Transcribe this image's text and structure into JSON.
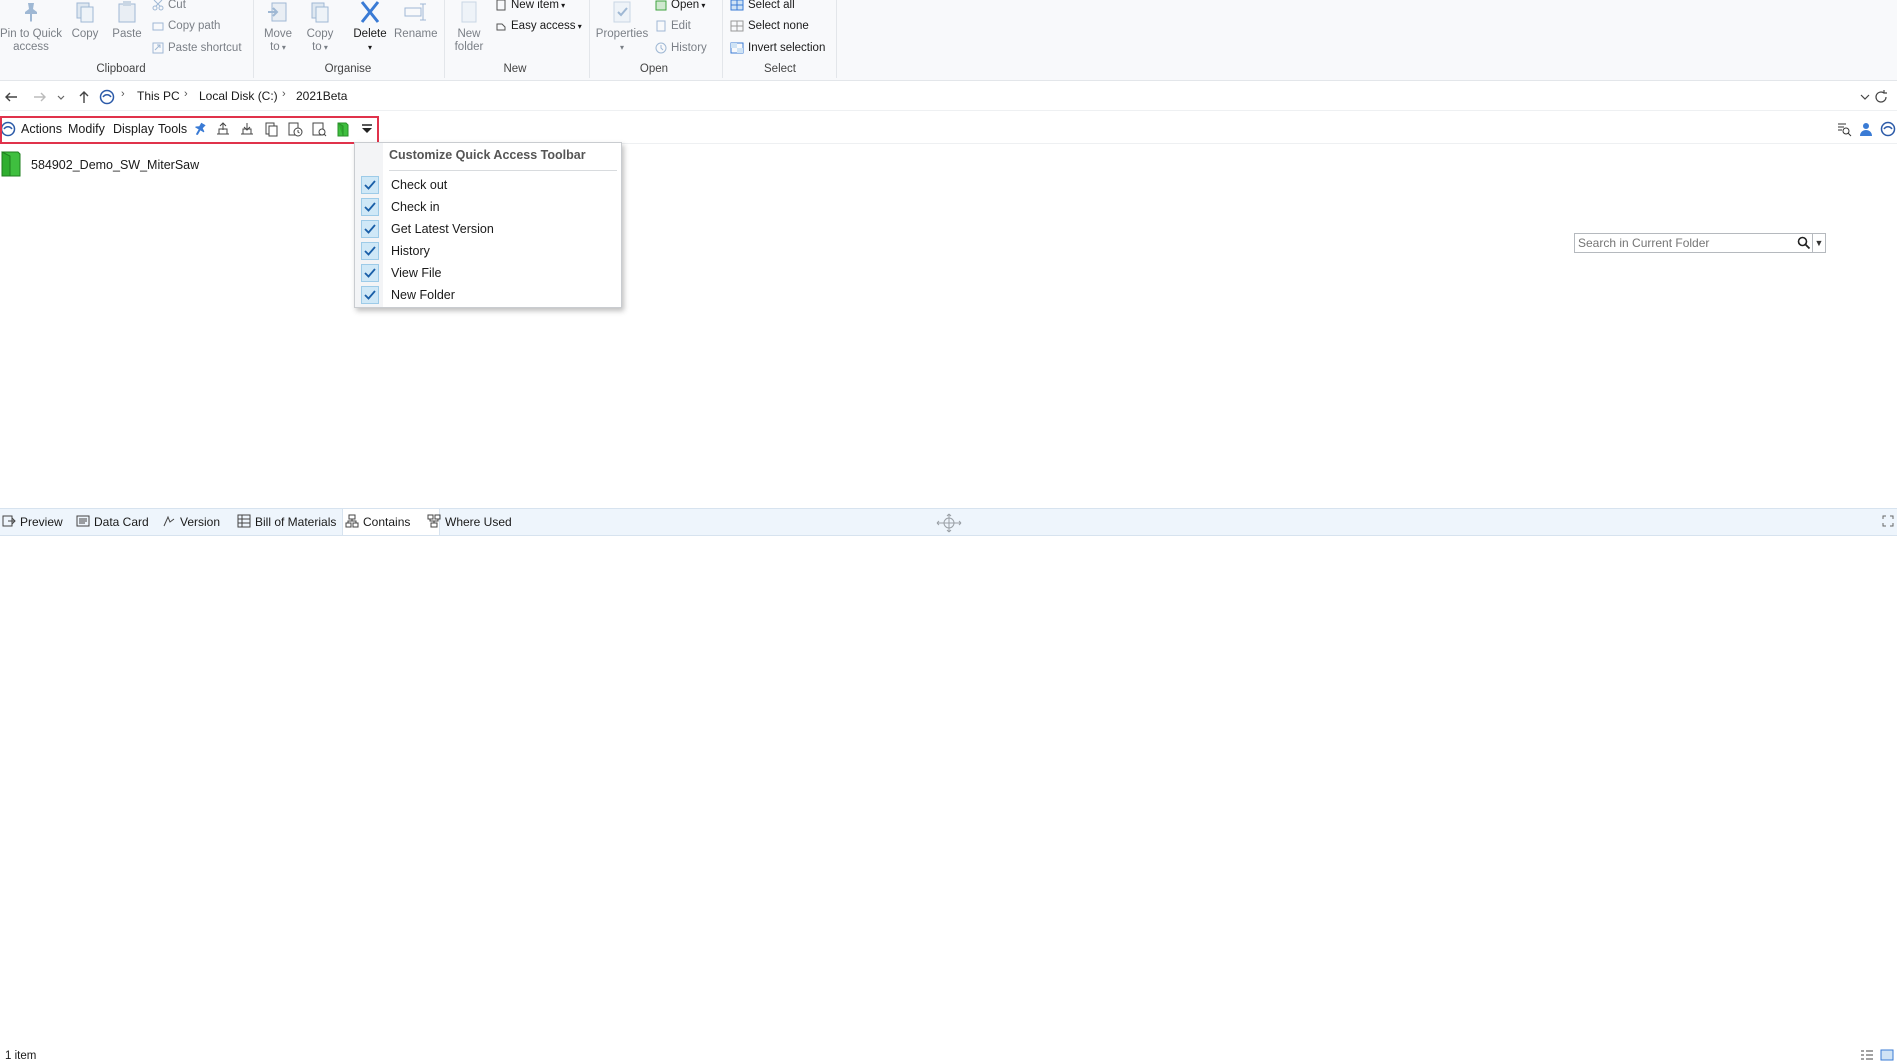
{
  "ribbon": {
    "clipboard": {
      "label": "Clipboard",
      "pin_label_1": "Pin to Quick",
      "pin_label_2": "access",
      "copy_label": "Copy",
      "paste_label": "Paste",
      "cut_label": "Cut",
      "copy_path_label": "Copy path",
      "paste_shortcut_label": "Paste shortcut"
    },
    "organise": {
      "label": "Organise",
      "move_label_1": "Move",
      "move_label_2": "to",
      "copy_label_1": "Copy",
      "copy_label_2": "to",
      "delete_label": "Delete",
      "rename_label": "Rename"
    },
    "new": {
      "label": "New",
      "new_folder_1": "New",
      "new_folder_2": "folder",
      "new_item_label": "New item",
      "easy_access_label": "Easy access"
    },
    "open": {
      "label": "Open",
      "properties_label": "Properties",
      "open_label": "Open",
      "edit_label": "Edit",
      "history_label": "History"
    },
    "select": {
      "label": "Select",
      "select_all_label": "Select all",
      "select_none_label": "Select none",
      "invert_label": "Invert selection"
    }
  },
  "address": {
    "crumbs": [
      "This PC",
      "Local Disk (C:)",
      "2021Beta"
    ]
  },
  "pdm_toolbar": {
    "menus": [
      "Actions",
      "Modify",
      "Display",
      "Tools"
    ],
    "search_placeholder": "Search in Current Folder"
  },
  "files": [
    {
      "name": "584902_Demo_SW_MiterSaw",
      "icon": "vault-folder-icon"
    }
  ],
  "qat_menu": {
    "title": "Customize Quick Access Toolbar",
    "items": [
      {
        "label": "Check out",
        "checked": true
      },
      {
        "label": "Check in",
        "checked": true
      },
      {
        "label": "Get Latest Version",
        "checked": true
      },
      {
        "label": "History",
        "checked": true
      },
      {
        "label": "View File",
        "checked": true
      },
      {
        "label": "New Folder",
        "checked": true
      }
    ]
  },
  "bottom_tabs": {
    "items": [
      "Preview",
      "Data Card",
      "Version",
      "Bill of Materials",
      "Contains",
      "Where Used"
    ],
    "active": "Contains"
  },
  "status": {
    "item_count": "1 item"
  },
  "colors": {
    "highlight_border": "#e0324b",
    "check_bg": "#cfe8f7",
    "vault_green": "#3fbf3f",
    "tab_strip_bg": "#eef5fc"
  }
}
